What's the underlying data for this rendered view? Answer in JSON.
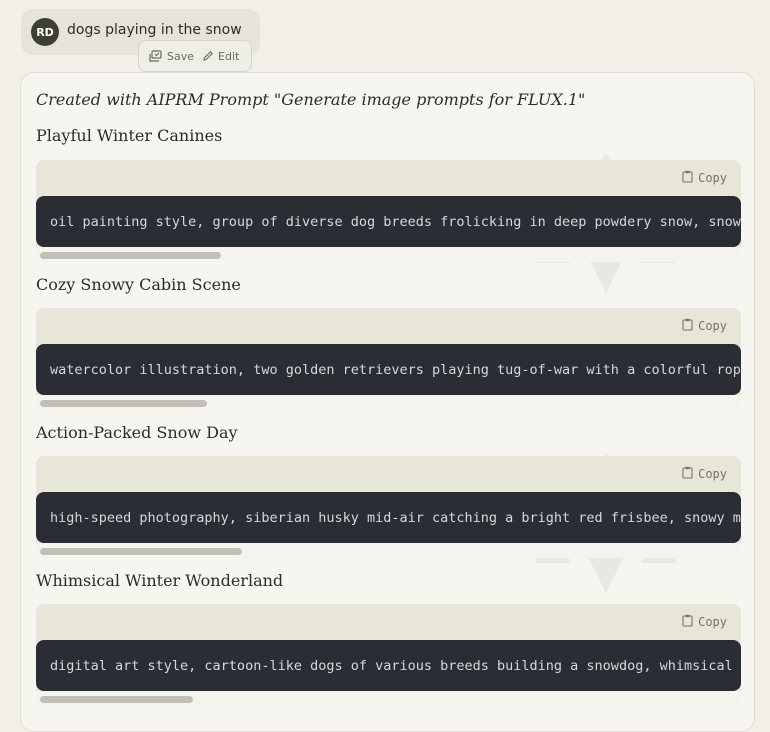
{
  "user_message": {
    "avatar_initials": "RD",
    "text": "dogs playing in the snow",
    "actions": {
      "save_label": "Save",
      "edit_label": "Edit"
    }
  },
  "response": {
    "credit": "Created with AIPRM Prompt \"Generate image prompts for FLUX.1\"",
    "watermark_text": "AIPRM",
    "copy_label": "Copy",
    "sections": [
      {
        "title": "Playful Winter Canines",
        "code": "oil painting style, group of diverse dog breeds frolicking in deep powdery snow, snow",
        "scroll_fraction": 0.26
      },
      {
        "title": "Cozy Snowy Cabin Scene",
        "code": "watercolor illustration, two golden retrievers playing tug-of-war with a colorful rope",
        "scroll_fraction": 0.24
      },
      {
        "title": "Action-Packed Snow Day",
        "code": "high-speed photography, siberian husky mid-air catching a bright red frisbee, snowy m",
        "scroll_fraction": 0.29
      },
      {
        "title": "Whimsical Winter Wonderland",
        "code": "digital art style, cartoon-like dogs of various breeds building a snowdog, whimsical",
        "scroll_fraction": 0.22
      }
    ]
  },
  "colors": {
    "page_bg": "#f1efe7",
    "code_bg": "#2b2d34",
    "block_header_bg": "#e8e6d9",
    "avatar_bg": "#3f3e36"
  },
  "icons": {
    "save": "save-icon",
    "edit": "pencil-icon",
    "copy": "clipboard-icon"
  }
}
